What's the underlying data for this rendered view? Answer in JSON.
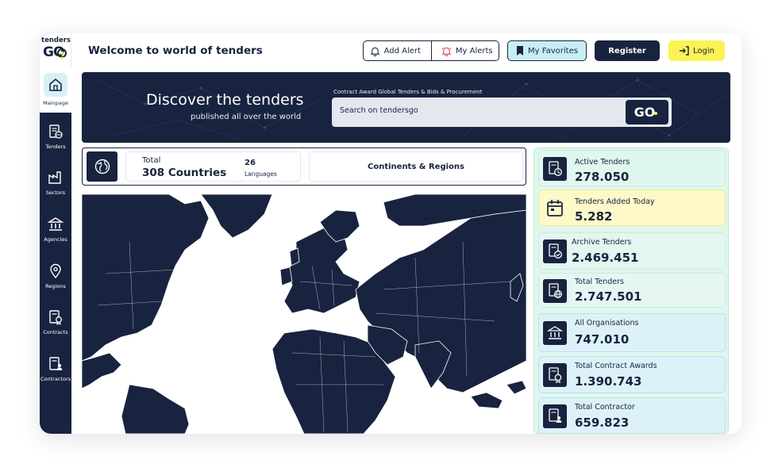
{
  "app": {
    "logo_top": "tenders",
    "logo_go": "GO"
  },
  "sidebar": {
    "items": [
      {
        "label": "Mainpage",
        "icon": "home-icon"
      },
      {
        "label": "Tenders",
        "icon": "tenders-icon"
      },
      {
        "label": "Sectors",
        "icon": "factory-icon"
      },
      {
        "label": "Agencies",
        "icon": "bank-icon"
      },
      {
        "label": "Regions",
        "icon": "map-pin-icon"
      },
      {
        "label": "Contracts",
        "icon": "contract-icon"
      },
      {
        "label": "Contractors",
        "icon": "contractor-icon"
      }
    ]
  },
  "header": {
    "title": "Welcome to world of tenders",
    "add_alert": "Add Alert",
    "my_alerts": "My Alerts",
    "my_favorites": "My Favorites",
    "register": "Register",
    "login": "Login"
  },
  "banner": {
    "heading": "Discover the tenders",
    "subheading": "published all over the world",
    "caption": "Contract Award Global Tenders & Bids & Procurement",
    "search_placeholder": "Search on tendersgo",
    "search_button": "GO"
  },
  "summary": {
    "total_label": "Total",
    "countries": "308 Countries",
    "languages_count": "26",
    "languages_label": "Languages",
    "continents_button": "Continents & Regions"
  },
  "stats": [
    {
      "label": "Active Tenders",
      "value": "278.050",
      "icon": "clock-document-icon"
    },
    {
      "label": "Tenders Added Today",
      "value": "5.282",
      "icon": "calendar-icon"
    },
    {
      "label": "Archive Tenders",
      "value": "2.469.451",
      "icon": "archive-check-icon"
    },
    {
      "label": "Total Tenders",
      "value": "2.747.501",
      "icon": "globe-document-icon"
    },
    {
      "label": "All Organisations",
      "value": "747.010",
      "icon": "bank-icon"
    },
    {
      "label": "Total Contract Awards",
      "value": "1.390.743",
      "icon": "award-document-icon"
    },
    {
      "label": "Total Contractor",
      "value": "659.823",
      "icon": "contractor-document-icon"
    }
  ],
  "colors": {
    "navy": "#18233f",
    "yellow": "#fbf253",
    "favorite_bg": "#c8eef5",
    "stats_green": "#dff7ee",
    "stats_yellow": "#fdf9c8",
    "stats_blue": "#ddf2f8"
  }
}
